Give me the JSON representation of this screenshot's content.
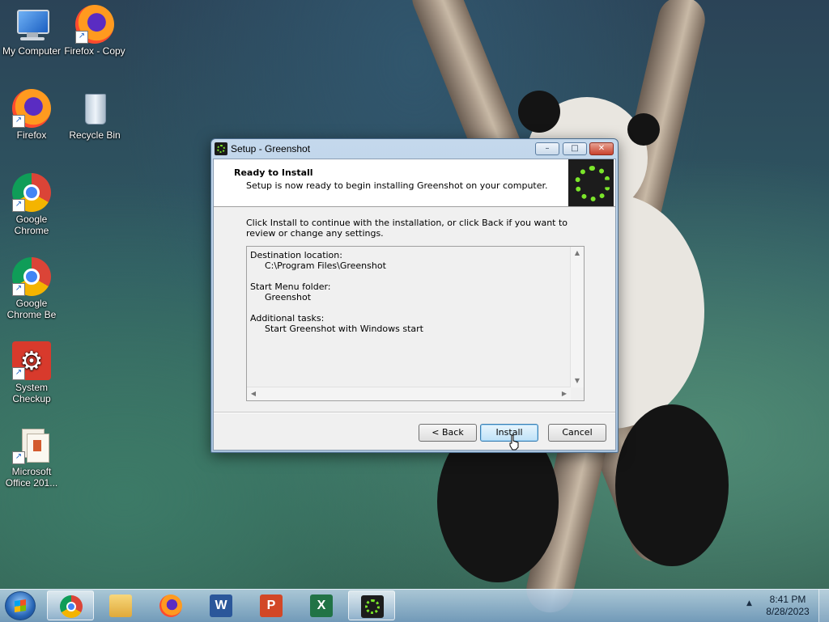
{
  "desktop": {
    "icons": [
      {
        "label": "My Computer"
      },
      {
        "label": "Firefox - Copy"
      },
      {
        "label": "Firefox"
      },
      {
        "label": "Recycle Bin"
      },
      {
        "label": "Google Chrome"
      },
      {
        "label": "Google Chrome Be"
      },
      {
        "label": "System Checkup"
      },
      {
        "label": "Microsoft Office 201..."
      }
    ]
  },
  "dialog": {
    "title": "Setup - Greenshot",
    "title_buttons": {
      "minimize": "–",
      "maximize": "□",
      "close": "✕"
    },
    "header": {
      "title": "Ready to Install",
      "subtitle": "Setup is now ready to begin installing Greenshot on your computer."
    },
    "instructions": "Click Install to continue with the installation, or click Back if you want to review or change any settings.",
    "summary": {
      "destination_label": "Destination location:",
      "destination_value": "C:\\Program Files\\Greenshot",
      "start_menu_label": "Start Menu folder:",
      "start_menu_value": "Greenshot",
      "tasks_label": "Additional tasks:",
      "tasks_value": "Start Greenshot with Windows start"
    },
    "buttons": {
      "back": "< Back",
      "install": "Install",
      "cancel": "Cancel"
    }
  },
  "taskbar": {
    "apps": [
      "chrome-icon",
      "explorer-icon",
      "firefox-icon",
      "word-icon",
      "powerpoint-icon",
      "excel-icon",
      "greenshot-icon"
    ],
    "word_glyph": "W",
    "ppt_glyph": "P",
    "excel_glyph": "X",
    "clock_time": "8:41 PM",
    "clock_date": "8/28/2023",
    "tray_arrow": "▲"
  },
  "colors": {
    "greenshot_green": "#7be62a",
    "close_red": "#c9422c"
  }
}
